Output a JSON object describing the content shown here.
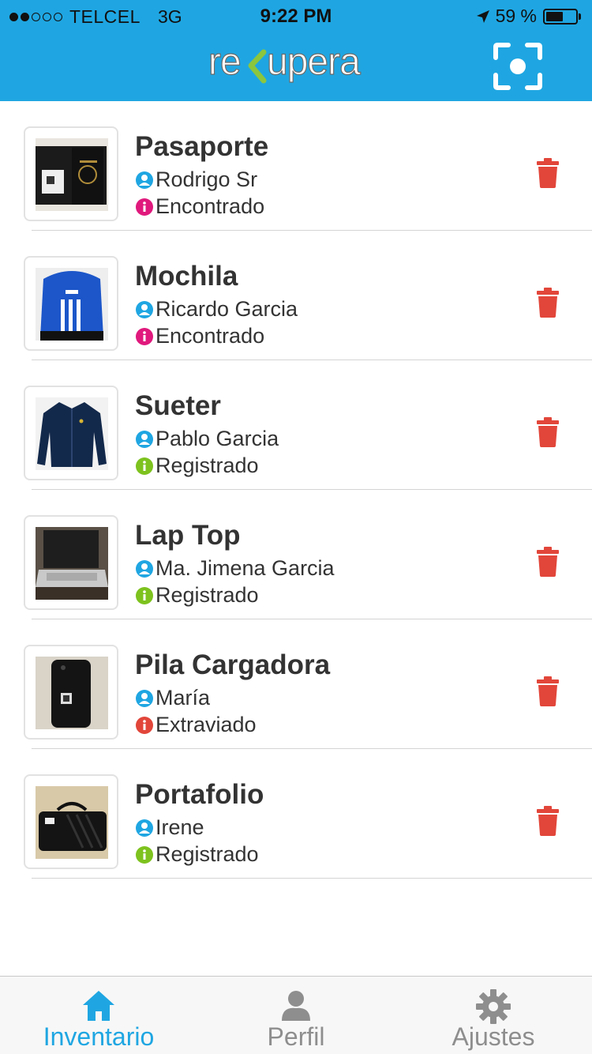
{
  "status_bar": {
    "carrier": "TELCEL",
    "network": "3G",
    "time": "9:22 PM",
    "battery": "59 %",
    "battery_level": 0.59,
    "signal_bars_filled": 2,
    "signal_bars_total": 5
  },
  "header": {
    "logo_text": "re upera",
    "background_color": "#1fa6e2",
    "scan_icon": "focus-scan-icon"
  },
  "items": [
    {
      "name": "Pasaporte",
      "owner": "Rodrigo Sr",
      "status": "Encontrado",
      "status_color": "#e0197d",
      "thumb": "passport"
    },
    {
      "name": "Mochila",
      "owner": "Ricardo Garcia",
      "status": "Encontrado",
      "status_color": "#e0197d",
      "thumb": "backpack"
    },
    {
      "name": "Sueter",
      "owner": "Pablo Garcia",
      "status": "Registrado",
      "status_color": "#7dc21e",
      "thumb": "sweater"
    },
    {
      "name": "Lap Top",
      "owner": "Ma. Jimena Garcia",
      "status": "Registrado",
      "status_color": "#7dc21e",
      "thumb": "laptop"
    },
    {
      "name": "Pila Cargadora",
      "owner": "María",
      "status": "Extraviado",
      "status_color": "#e2463a",
      "thumb": "battery-case"
    },
    {
      "name": "Portafolio",
      "owner": "Irene",
      "status": "Registrado",
      "status_color": "#7dc21e",
      "thumb": "briefcase"
    }
  ],
  "tabs": [
    {
      "label": "Inventario",
      "icon": "home-icon",
      "active": true
    },
    {
      "label": "Perfil",
      "icon": "profile-icon",
      "active": false
    },
    {
      "label": "Ajustes",
      "icon": "gear-icon",
      "active": false
    }
  ],
  "colors": {
    "accent": "#1fa6e2",
    "delete": "#e2463a",
    "owner_icon": "#1fa6e2"
  }
}
